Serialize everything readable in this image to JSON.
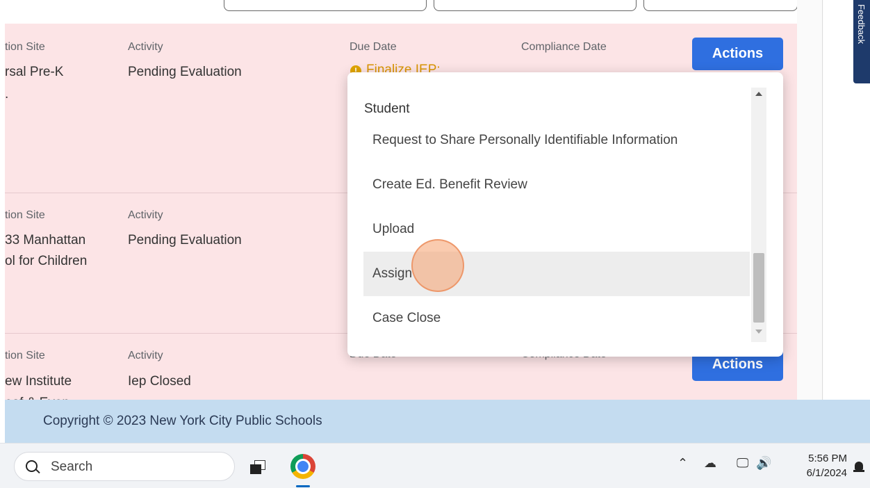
{
  "top": {
    "caption": ""
  },
  "feedback": {
    "label": "Feedback"
  },
  "rows": [
    {
      "site_label": "tion Site",
      "site_value_lines": [
        "rsal Pre-K",
        "."
      ],
      "activity_label": "Activity",
      "activity_value": "Pending Evaluation",
      "due_label": "Due Date",
      "due_value": "Finalize IEP:",
      "compliance_label": "Compliance Date",
      "actions_label": "Actions"
    },
    {
      "site_label": "tion Site",
      "site_value_lines": [
        "33 Manhattan",
        "ol for Children"
      ],
      "activity_label": "Activity",
      "activity_value": "Pending Evaluation"
    },
    {
      "site_label": "tion Site",
      "site_value_lines": [
        "ew Institute",
        "eaf & Even"
      ],
      "activity_label": "Activity",
      "activity_value": "Iep Closed",
      "due_label": "Due Date",
      "compliance_label": "Compliance Date",
      "actions_label": "Actions"
    }
  ],
  "dropdown": {
    "group_label": "Student",
    "items": [
      "Request to Share Personally Identifiable Information",
      "Create Ed. Benefit Review",
      "Upload",
      "Assign",
      "Case Close"
    ],
    "hovered_item": "Assign"
  },
  "footer": {
    "copyright": "Copyright © 2023 New York City Public Schools"
  },
  "taskbar": {
    "search_label": "Search",
    "time": "5:56 PM",
    "date": "6/1/2024",
    "tray_icons": [
      "chevron-up-icon",
      "cloud-off-icon",
      "network-icon",
      "volume-icon"
    ]
  },
  "colors": {
    "row_background": "#fce4e6",
    "actions_button": "#2f6fe0",
    "footer_background": "#c4dcf0",
    "warning": "#e0a400"
  }
}
